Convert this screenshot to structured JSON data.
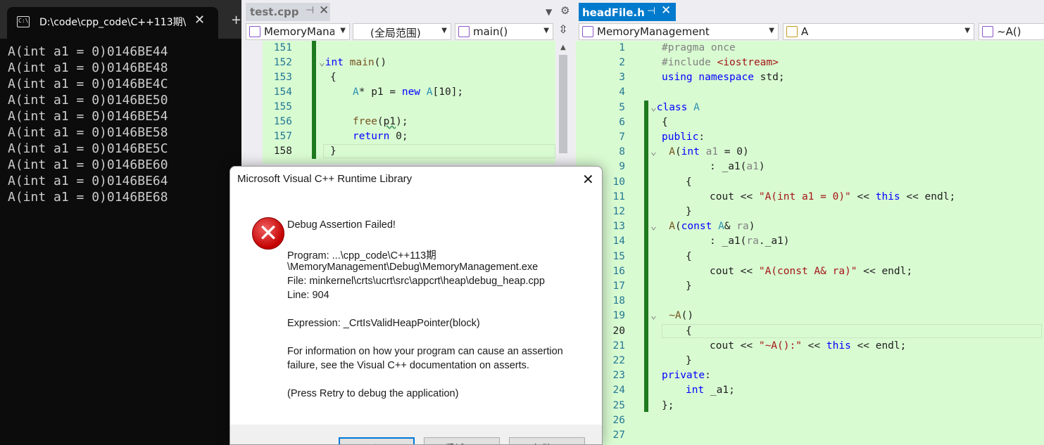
{
  "console": {
    "tab_title": "D:\\code\\cpp_code\\C++113期\\I",
    "tab_icon": "console-icon",
    "lines": [
      "A(int a1 = 0)0146BE44",
      "A(int a1 = 0)0146BE48",
      "A(int a1 = 0)0146BE4C",
      "A(int a1 = 0)0146BE50",
      "A(int a1 = 0)0146BE54",
      "A(int a1 = 0)0146BE58",
      "A(int a1 = 0)0146BE5C",
      "A(int a1 = 0)0146BE60",
      "A(int a1 = 0)0146BE64",
      "A(int a1 = 0)0146BE68"
    ]
  },
  "test_editor": {
    "tab_title": "test.cpp",
    "project_combo": "MemoryMana",
    "scope_combo": "(全局范围)",
    "member_combo": "main()",
    "line_numbers": [
      "151",
      "152",
      "153",
      "154",
      "155",
      "156",
      "157",
      "158"
    ],
    "current_line": "158"
  },
  "head_editor": {
    "tab_title": "headFile.h",
    "project_combo": "MemoryManagement",
    "class_combo": "A",
    "member_combo": "~A()",
    "line_numbers": [
      "1",
      "2",
      "3",
      "4",
      "5",
      "6",
      "7",
      "8",
      "9",
      "10",
      "11",
      "12",
      "13",
      "14",
      "15",
      "16",
      "17",
      "18",
      "19",
      "20",
      "21",
      "22",
      "23",
      "24",
      "25",
      "26",
      "27"
    ],
    "current_line": "20"
  },
  "dialog": {
    "title": "Microsoft Visual C++ Runtime Library",
    "heading": "Debug Assertion Failed!",
    "program_line1": "Program: ...\\cpp_code\\C++113期",
    "program_line2": "\\MemoryManagement\\Debug\\MemoryManagement.exe",
    "file_line": "File: minkernel\\crts\\ucrt\\src\\appcrt\\heap\\debug_heap.cpp",
    "line_line": "Line: 904",
    "expression_line": "Expression: _CrtIsValidHeapPointer(block)",
    "info_line1": "For information on how your program can cause an assertion",
    "info_line2": "failure, see the Visual C++ documentation on asserts.",
    "retry_hint": "(Press Retry to debug the application)",
    "buttons": {
      "abort": "中止(A)",
      "retry": "重试(R)",
      "ignore": "忽略(I)"
    },
    "icon": "error-icon"
  },
  "colors": {
    "editor_background": "#d9fbd2",
    "change_indicator": "#1f7a1f",
    "active_tab": "#007acc",
    "console_background": "#0c0c0c"
  }
}
